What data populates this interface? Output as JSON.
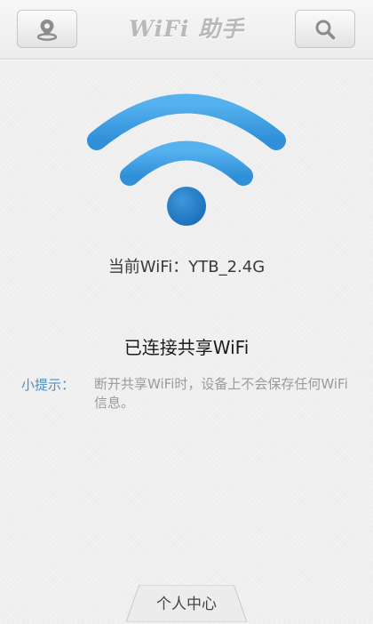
{
  "header": {
    "title": "WiFi 助手",
    "left_button_icon": "location-pin-icon",
    "right_button_icon": "search-icon"
  },
  "main": {
    "wifi_icon": "wifi-signal-icon",
    "current_wifi": "当前WiFi：YTB_2.4G",
    "status": "已连接共享WiFi",
    "tip_label": "小提示：",
    "tip_text": "断开共享WiFi时，设备上不会保存任何WiFi信息。"
  },
  "footer": {
    "personal_center_label": "个人中心"
  },
  "colors": {
    "wifi_blue": "#3b9ee0",
    "wifi_dot": "#1f78c4",
    "tip_blue": "#4a90c8"
  }
}
